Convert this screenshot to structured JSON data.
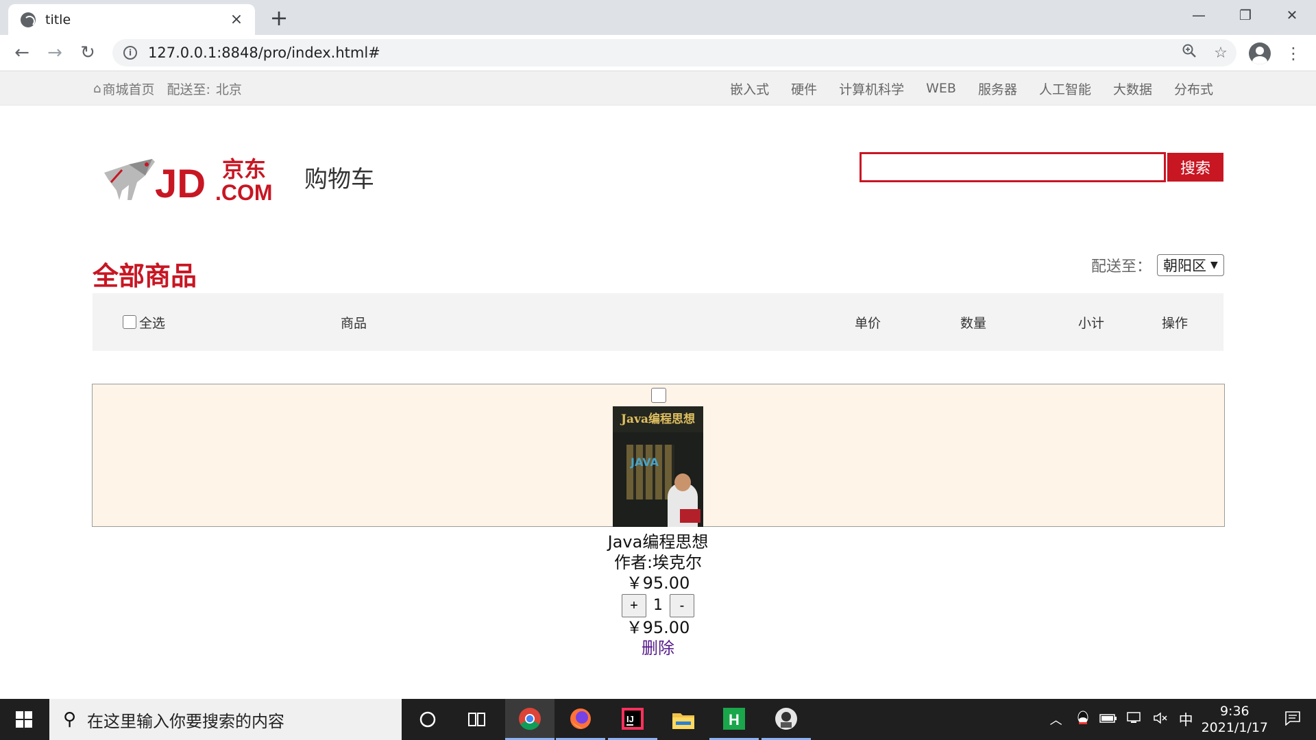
{
  "browser": {
    "tab_title": "title",
    "tab_close": "×",
    "new_tab": "+",
    "url": "127.0.0.1:8848/pro/index.html#",
    "window_controls": {
      "minimize": "—",
      "maximize": "❐",
      "close": "✕"
    },
    "nav": {
      "back": "←",
      "forward": "→",
      "reload": "↻"
    },
    "icons": {
      "zoom": "zoom-icon",
      "bookmark": "star-icon",
      "menu": "kebab-icon"
    }
  },
  "shortcut": {
    "home": "商城首页",
    "deliver_label": "配送至:",
    "deliver_city": "北京",
    "categories": [
      "嵌入式",
      "硬件",
      "计算机科学",
      "WEB",
      "服务器",
      "人工智能",
      "大数据",
      "分布式"
    ]
  },
  "header": {
    "logo_text": "JD",
    "logo_cn": "京东",
    "logo_com": ".COM",
    "cart_title": "购物车",
    "search_value": "",
    "search_button": "搜索"
  },
  "cart": {
    "all_goods": "全部商品",
    "delivery_label": "配送至：",
    "delivery_district": "朝阳区",
    "columns": {
      "select_all": "全选",
      "product": "商品",
      "unit_price": "单价",
      "quantity": "数量",
      "subtotal": "小计",
      "action": "操作"
    },
    "items": [
      {
        "book_cover_title": "Java编程思想",
        "name": "Java编程思想",
        "author": "作者:埃克尔",
        "price": "￥95.00",
        "plus": "+",
        "quantity": "1",
        "minus": "-",
        "subtotal": "￥95.00",
        "delete": "删除"
      }
    ]
  },
  "taskbar": {
    "search_placeholder": "在这里输入你要搜索的内容",
    "ime": "中",
    "time": "9:36",
    "date": "2021/1/17"
  },
  "colors": {
    "brand_red": "#c81623",
    "row_bg": "#fff4e8",
    "header_bg": "#f3f3f3"
  }
}
